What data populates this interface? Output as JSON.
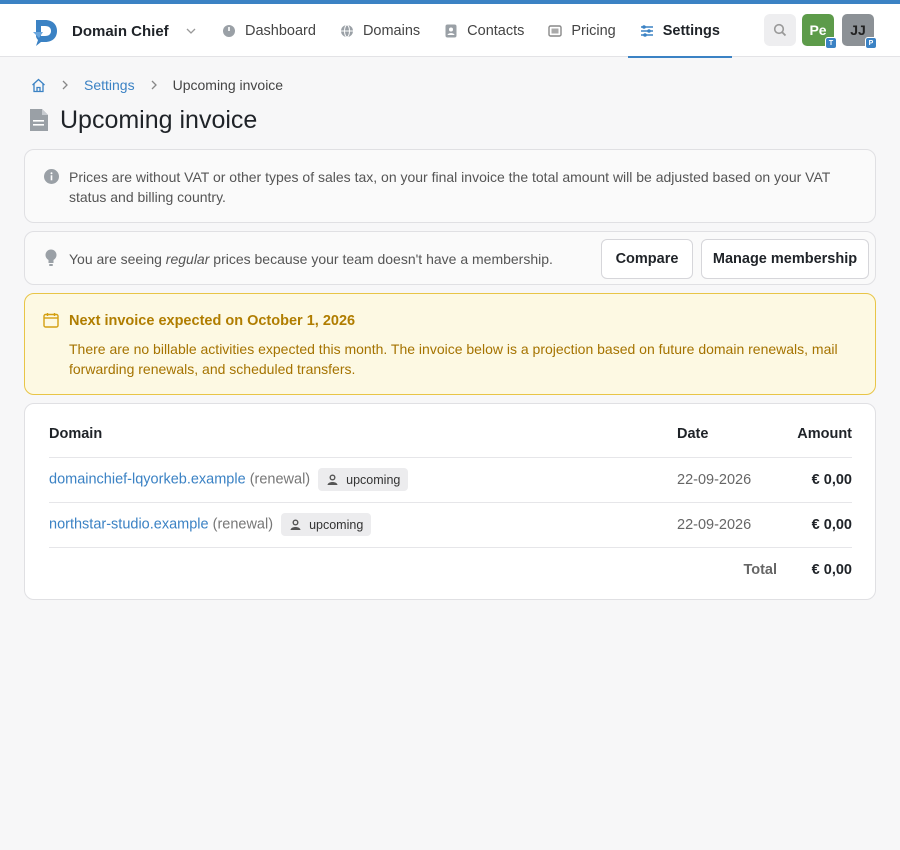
{
  "colors": {
    "accent": "#3b82c4",
    "warning_text": "#b07d00",
    "warning_bg": "#fdf9e3",
    "avatar1": "#5d9b4a",
    "avatar2": "#8c9196"
  },
  "header": {
    "brand_name": "Domain Chief",
    "nav": [
      {
        "label": "Dashboard",
        "icon": "dashboard-gauge-icon"
      },
      {
        "label": "Domains",
        "icon": "globe-icon"
      },
      {
        "label": "Contacts",
        "icon": "contact-card-icon"
      },
      {
        "label": "Pricing",
        "icon": "pricing-tag-icon"
      },
      {
        "label": "Settings",
        "icon": "settings-sliders-icon",
        "active": true
      }
    ],
    "avatars": [
      {
        "initials": "Pe",
        "badge": "T"
      },
      {
        "initials": "JJ",
        "badge": "P"
      }
    ]
  },
  "breadcrumb": {
    "home_icon": "home-icon",
    "settings": "Settings",
    "current": "Upcoming invoice"
  },
  "page": {
    "title": "Upcoming invoice"
  },
  "info": {
    "text": "Prices are without VAT or other types of sales tax, on your final invoice the total amount will be adjusted based on your VAT status and billing country."
  },
  "membership": {
    "text_before": "You are seeing ",
    "text_emphasis": "regular",
    "text_after": " prices because your team doesn't have a membership.",
    "compare_label": "Compare",
    "manage_label": "Manage membership"
  },
  "notice": {
    "title": "Next invoice expected on October 1, 2026",
    "text": "There are no billable activities expected this month. The invoice below is a projection based on future domain renewals, mail forwarding renewals, and scheduled transfers."
  },
  "table": {
    "headers": {
      "domain": "Domain",
      "date": "Date",
      "amount": "Amount"
    },
    "rows": [
      {
        "domain": "domainchief-lqyorkeb.example",
        "kind": "(renewal)",
        "badge": "upcoming",
        "date": "22-09-2026",
        "amount": "€ 0,00"
      },
      {
        "domain": "northstar-studio.example",
        "kind": "(renewal)",
        "badge": "upcoming",
        "date": "22-09-2026",
        "amount": "€ 0,00"
      }
    ],
    "total_label": "Total",
    "total_amount": "€ 0,00"
  }
}
